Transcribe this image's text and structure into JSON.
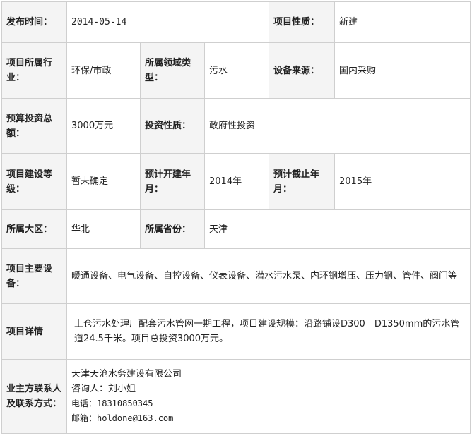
{
  "rows": {
    "publish_time": {
      "label": "发布时间：",
      "value": "2014-05-14"
    },
    "project_nature": {
      "label": "项目性质：",
      "value": "新建"
    },
    "industry": {
      "label": "项目所属行业：",
      "value": "环保/市政"
    },
    "domain": {
      "label": "所属领域类型：",
      "value": "污水"
    },
    "equipment_source": {
      "label": "设备来源：",
      "value": "国内采购"
    },
    "budget": {
      "label": "预算投资总额：",
      "value": "3000万元"
    },
    "investment_nature": {
      "label": "投资性质：",
      "value": "政府性投资"
    },
    "construction_level": {
      "label": "项目建设等级：",
      "value": "暂未确定"
    },
    "planned_start": {
      "label": "预计开建年月：",
      "value": "2014年"
    },
    "planned_end": {
      "label": "预计截止年月：",
      "value": "2015年"
    },
    "region": {
      "label": "所属大区：",
      "value": "华北"
    },
    "province": {
      "label": "所属省份：",
      "value": "天津"
    },
    "main_equipment": {
      "label": "项目主要设备：",
      "value": "暖通设备、电气设备、自控设备、仪表设备、潜水污水泵、内环钢增压、压力钢、管件、阀门等"
    },
    "details": {
      "label": "项目详情",
      "value": "上仓污水处理厂配套污水管网一期工程，项目建设规模：沿路铺设D300—D1350mm的污水管道24.5千米。项目总投资3000万元。"
    },
    "contact": {
      "label": "业主方联系人及联系方式：",
      "company": "天津天沧水务建设有限公司",
      "consultant": "咨询人：刘小姐",
      "phone": "电话：18310850345",
      "email": "邮箱：holdone@163.com"
    }
  }
}
